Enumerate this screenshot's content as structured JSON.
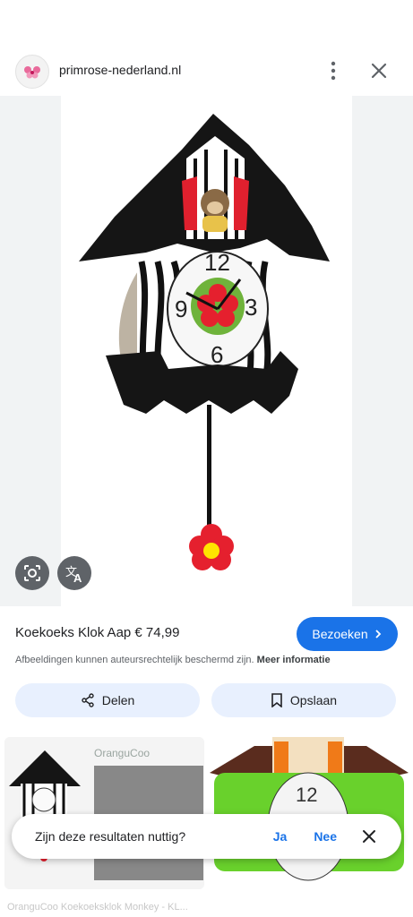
{
  "header": {
    "site": "primrose-nederland.nl",
    "favicon_icon": "flower-favicon-icon",
    "menu_icon": "more-vert-icon",
    "close_icon": "close-icon"
  },
  "image": {
    "clock_numbers": [
      "12",
      "3",
      "6",
      "9"
    ]
  },
  "overlay_buttons": {
    "lens_icon": "google-lens-icon",
    "translate_icon": "translate-icon"
  },
  "product": {
    "title": "Koekoeks Klok Aap € 74,99",
    "visit_label": "Bezoeken",
    "copyright_text": "Afbeeldingen kunnen auteursrechtelijk beschermd zijn.",
    "more_info": "Meer informatie"
  },
  "actions": {
    "share_label": "Delen",
    "save_label": "Opslaan"
  },
  "related": {
    "thumb1_brand": "OranguCoo",
    "thumb1_caption": "OranguCoo Koekoeksklok Monkey - KL...",
    "thumb2_clock_number": "12"
  },
  "feedback": {
    "question": "Zijn deze resultaten nuttig?",
    "yes": "Ja",
    "no": "Nee"
  },
  "colors": {
    "accent": "#1a73e8",
    "pill_bg": "#e8f0fe"
  }
}
